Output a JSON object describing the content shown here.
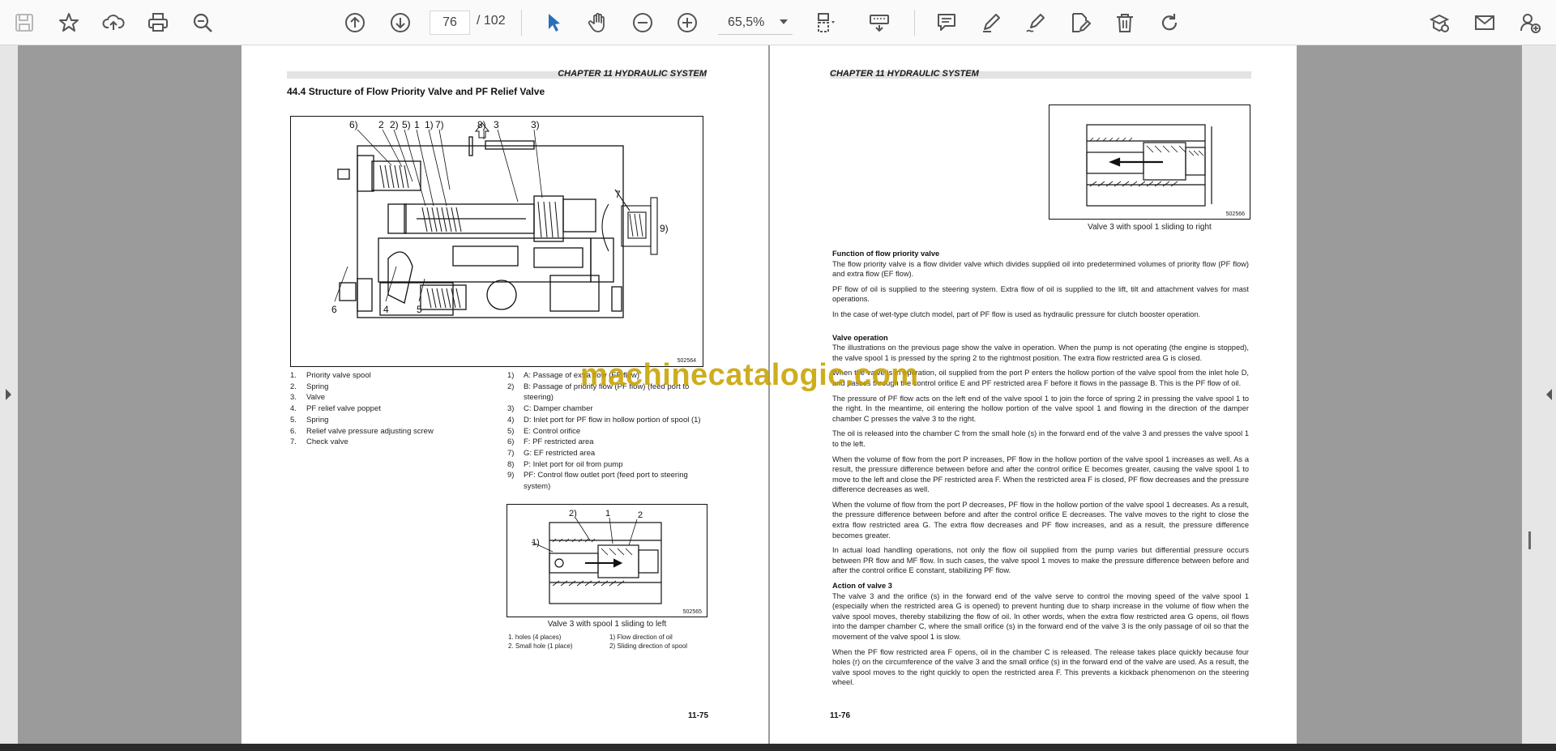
{
  "toolbar": {
    "page_current": "76",
    "page_total": "/ 102",
    "zoom_value": "65,5%"
  },
  "left_page": {
    "chapter_header": "CHAPTER 11 HYDRAULIC SYSTEM",
    "section_title": "44.4    Structure of Flow Priority Valve and PF Relief Valve",
    "figure1": {
      "code": "502564",
      "labels_top": [
        "6)",
        "2",
        "2)",
        "5)",
        "1",
        "1)",
        "7)",
        "8)",
        "3",
        "3)"
      ],
      "labels_bottom": [
        "6",
        "4",
        "5"
      ],
      "label_side_7": "7",
      "label_side_9": "9)"
    },
    "legend_parts": [
      {
        "n": "1.",
        "t": "Priority valve spool"
      },
      {
        "n": "2.",
        "t": "Spring"
      },
      {
        "n": "3.",
        "t": "Valve"
      },
      {
        "n": "4.",
        "t": "PF relief valve poppet"
      },
      {
        "n": "5.",
        "t": "Spring"
      },
      {
        "n": "6.",
        "t": "Relief valve pressure adjusting screw"
      },
      {
        "n": "7.",
        "t": "Check valve"
      }
    ],
    "legend_areas": [
      {
        "n": "1)",
        "t": "A: Passage of extra flow (EF flow)"
      },
      {
        "n": "2)",
        "t": "B: Passage of priority flow (PF flow) (feed port to steering)"
      },
      {
        "n": "3)",
        "t": "C: Damper chamber"
      },
      {
        "n": "4)",
        "t": "D: Inlet port for PF flow in hollow portion of spool (1)"
      },
      {
        "n": "5)",
        "t": "E: Control orifice"
      },
      {
        "n": "6)",
        "t": "F: PF restricted area"
      },
      {
        "n": "7)",
        "t": "G: EF restricted area"
      },
      {
        "n": "8)",
        "t": "P: Inlet port for oil from pump"
      },
      {
        "n": "9)",
        "t": "PF: Control flow outlet port (feed port to steering system)"
      }
    ],
    "figure2": {
      "code": "502565",
      "caption": "Valve 3 with spool 1 sliding to left",
      "labels": [
        "2)",
        "1",
        "2",
        "1)"
      ]
    },
    "figure2_legend": [
      "1. holes (4 places)",
      "1) Flow direction of oil",
      "2. Small hole (1 place)",
      "2) Sliding direction of spool"
    ],
    "page_number": "11-75"
  },
  "right_page": {
    "chapter_header": "CHAPTER 11 HYDRAULIC SYSTEM",
    "figure3": {
      "code": "502566",
      "caption": "Valve 3 with spool 1 sliding to right"
    },
    "h_function": "Function of flow priority valve",
    "p_function": [
      "The flow priority valve is a flow divider valve which divides supplied oil into predetermined volumes of priority flow (PF flow) and extra flow (EF flow).",
      "PF flow of oil is supplied to the steering system. Extra flow of oil is supplied to the lift, tilt and attachment valves for mast operations.",
      "In the case of wet-type clutch model, part of PF flow is used as hydraulic pressure for clutch booster operation."
    ],
    "h_operation": "Valve operation",
    "p_operation": [
      "The illustrations on the previous page show the valve in operation. When the pump is not operating (the engine is stopped), the valve spool 1 is pressed by the spring 2 to the rightmost position. The extra flow restricted area G is closed.",
      "When the valve is in operation, oil supplied from the port P enters the hollow portion of the valve spool from the inlet hole D, and passes through the control orifice E and PF restricted area F before it flows in the passage B. This is the PF flow of oil.",
      "The pressure of PF flow acts on the left end of the valve spool 1 to join the force of spring 2 in pressing the valve spool 1 to the right. In the meantime, oil entering the hollow portion of the valve spool 1 and flowing in the direction of the damper chamber C presses the valve 3 to the right.",
      "The oil is released into the chamber C from the small hole (s) in the forward end of the valve 3 and presses the valve spool 1 to the left.",
      "When the volume of flow from the port P increases, PF flow in the hollow portion of the valve spool 1 increases as well. As a result, the pressure difference between before and after the control orifice E becomes greater, causing the valve spool 1 to move to the left and close the PF restricted area F. When the restricted area F is closed, PF flow decreases and the pressure difference decreases as well.",
      "When the volume of flow from the port P decreases, PF flow in the hollow portion of the valve spool 1 decreases. As a result, the pressure difference between before and after the control orifice E decreases. The valve moves to the right to close the extra flow restricted area G. The extra flow decreases and PF flow increases, and as a result, the pressure difference becomes greater.",
      "In actual load handling operations, not only the flow oil supplied from the pump varies but differential pressure occurs between PR flow and MF flow. In such cases, the valve spool 1 moves to make the pressure difference between before and after the control orifice E constant, stabilizing PF flow."
    ],
    "h_action": "Action of valve 3",
    "p_action": [
      "The valve 3 and the orifice (s) in the forward end of the valve serve to control the moving speed of the valve spool 1 (especially when the restricted area G is opened) to prevent hunting due to sharp increase in the volume of flow when the valve spool moves, thereby stabilizing the flow of oil. In other words, when the extra flow restricted area G opens, oil flows into the damper chamber C, where the small orifice (s) in the forward end of the valve 3 is the only passage of oil so that the movement of the valve spool 1 is slow.",
      "When the PF flow restricted area F opens, oil in the chamber C is released. The release takes place quickly because four holes (r) on the circumference of the valve 3 and the small orifice (s) in the forward end of the valve are used. As a result, the valve spool moves to the right quickly to open the restricted area F. This prevents a kickback phenomenon on the steering wheel."
    ],
    "page_number": "11-76"
  },
  "watermark": "machinecatalogic.com",
  "colors": {
    "accent_blue": "#2a6ebb",
    "icon_gray": "#555555",
    "watermark": "#c8a200"
  }
}
